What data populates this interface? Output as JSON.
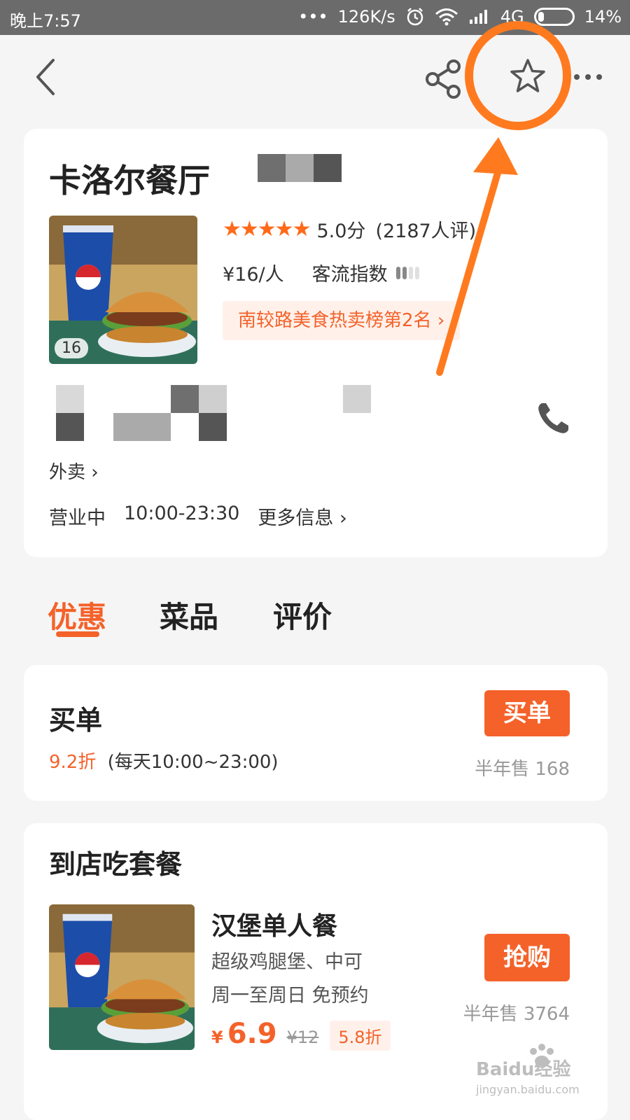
{
  "status_bar": {
    "time": "晚上7:57",
    "dots": "•••",
    "speed": "126K/s",
    "network": "4G",
    "battery": "14%"
  },
  "nav": {
    "back": "back-icon",
    "share": "share-icon",
    "favorite": "star-icon",
    "more": "more-icon"
  },
  "shop": {
    "name": "卡洛尔餐厅",
    "photo_count": "16",
    "stars": "★★★★★",
    "score": "5.0分",
    "reviews": "(2187人评)",
    "price_per_person": "¥16/人",
    "traffic_label": "客流指数",
    "traffic_level": 0.5,
    "rank_badge": "南较路美食热卖榜第2名",
    "waimai": "外卖",
    "status": "营业中",
    "hours": "10:00-23:30",
    "more_info": "更多信息"
  },
  "tabs": [
    {
      "label": "优惠",
      "active": true
    },
    {
      "label": "菜品",
      "active": false
    },
    {
      "label": "评价",
      "active": false
    }
  ],
  "pay": {
    "title": "买单",
    "rate": "9.2折",
    "time": "(每天10:00~23:00)",
    "button": "买单",
    "sold": "半年售 168"
  },
  "set_meal": {
    "section_title": "到店吃套餐",
    "name": "汉堡单人餐",
    "desc1": "超级鸡腿堡、中可",
    "desc2": "周一至周日  免预约",
    "currency": "¥",
    "price": "6.9",
    "original": "¥12",
    "discount": "5.8折",
    "button": "抢购",
    "sold": "半年售 3764"
  },
  "watermark": {
    "brand": "Baidu经验",
    "url": "jingyan.baidu.com"
  },
  "colors": {
    "accent": "#f4622a",
    "annotation": "#ff7a1f",
    "status_bar": "#6b6b6b"
  }
}
